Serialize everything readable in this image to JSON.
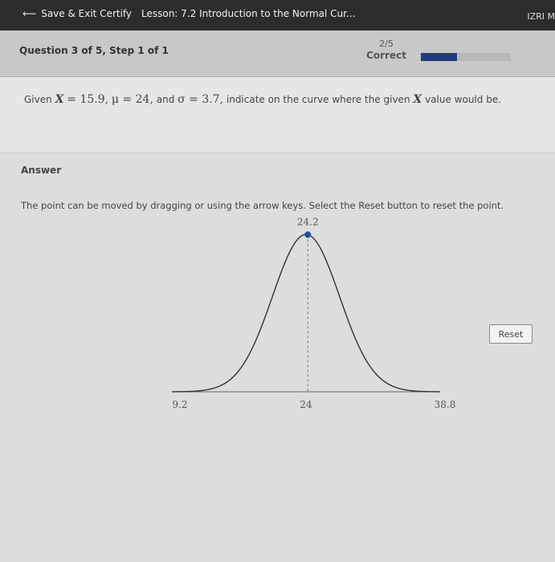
{
  "topbar": {
    "back_label": "Save & Exit Certify",
    "lesson_title": "Lesson: 7.2 Introduction to the Normal Cur...",
    "user": "IZRI M"
  },
  "question_header": {
    "step": "Question 3 of 5, Step 1 of 1",
    "score": "2/5",
    "score_status": "Correct",
    "progress_fraction": 0.4
  },
  "question": {
    "prefix": "Given",
    "x_var": "X",
    "x_value": "= 15.9,",
    "mu_part": "μ = 24,",
    "and_word": "and",
    "sigma_part": "σ = 3.7,",
    "suffix_a": "indicate on the curve where the given",
    "suffix_b": "value would be."
  },
  "answer": {
    "label": "Answer",
    "instructions": "The point can be moved by dragging or using the arrow keys. Select the Reset button to reset the point.",
    "reset_label": "Reset"
  },
  "graph": {
    "mean": 24,
    "sd": 3.7,
    "x_min": 9.2,
    "x_max": 38.8,
    "point_x": 24.2,
    "point_label": "24.2",
    "tick_labels": [
      "9.2",
      "24",
      "38.8"
    ],
    "curve_color": "#333333",
    "point_color": "#1f4fa0"
  }
}
